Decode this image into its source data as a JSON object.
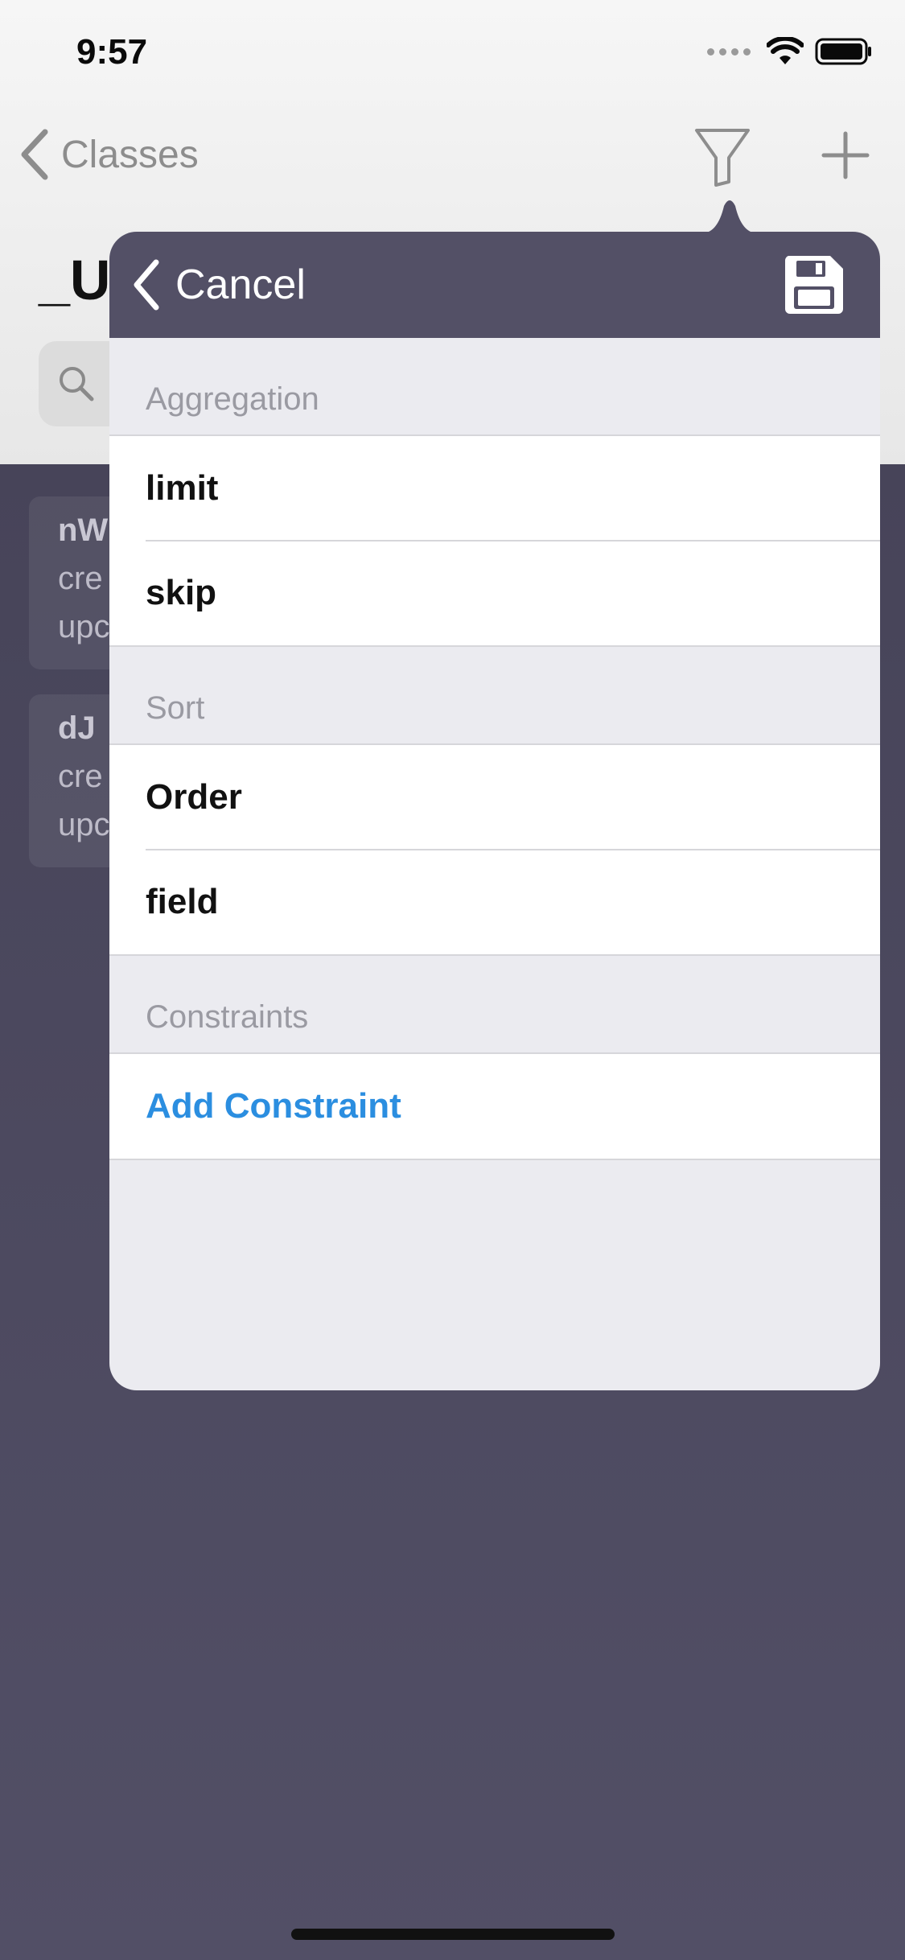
{
  "status_bar": {
    "time": "9:57"
  },
  "nav": {
    "back_label": "Classes",
    "page_title": "_User"
  },
  "background_objects": [
    {
      "id": "nW",
      "line1": "cre",
      "line2": "upc"
    },
    {
      "id": "dJ",
      "line1": "cre",
      "line2": "upc"
    }
  ],
  "popover": {
    "cancel_label": "Cancel",
    "sections": {
      "aggregation": {
        "header": "Aggregation",
        "rows": [
          "limit",
          "skip"
        ]
      },
      "sort": {
        "header": "Sort",
        "rows": [
          "Order",
          "field"
        ]
      },
      "constraints": {
        "header": "Constraints",
        "action": "Add Constraint"
      }
    }
  },
  "icons": {
    "back": "chevron-left-icon",
    "filter": "filter-icon",
    "add": "plus-icon",
    "search": "search-icon",
    "save": "floppy-disk-icon"
  },
  "colors": {
    "popover_header": "#535066",
    "link": "#2b8ee0",
    "overlay": "#4d4a60"
  }
}
